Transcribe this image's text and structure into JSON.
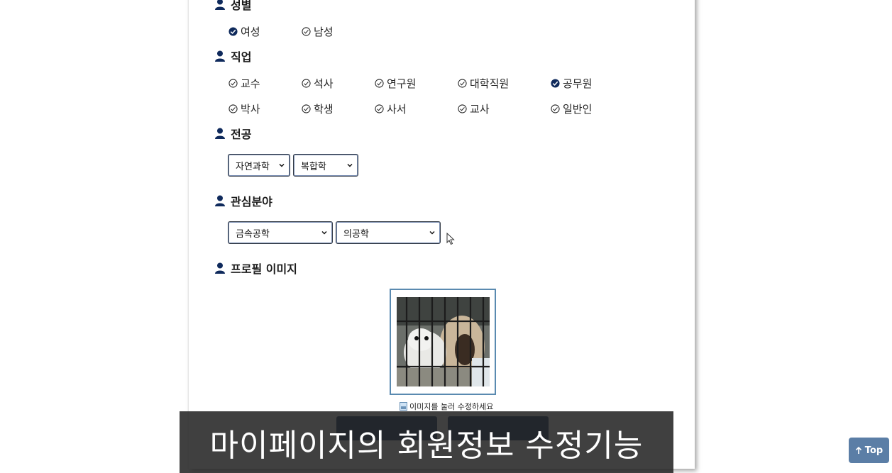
{
  "sections": {
    "gender": {
      "title": "성별",
      "options": [
        {
          "label": "여성",
          "checked": true
        },
        {
          "label": "남성",
          "checked": false
        }
      ]
    },
    "job": {
      "title": "직업",
      "options": [
        {
          "label": "교수",
          "checked": false
        },
        {
          "label": "석사",
          "checked": false
        },
        {
          "label": "연구원",
          "checked": false
        },
        {
          "label": "대학직원",
          "checked": false
        },
        {
          "label": "공무원",
          "checked": true
        },
        {
          "label": "박사",
          "checked": false
        },
        {
          "label": "학생",
          "checked": false
        },
        {
          "label": "사서",
          "checked": false
        },
        {
          "label": "교사",
          "checked": false
        },
        {
          "label": "일반인",
          "checked": false
        }
      ]
    },
    "major": {
      "title": "전공",
      "select1": "자연과학",
      "select2": "복합학"
    },
    "interest": {
      "title": "관심분야",
      "select1": "금속공학",
      "select2": "의공학"
    },
    "profile": {
      "title": "프로필 이미지",
      "hint": "이미지를 눌러 수정하세요"
    }
  },
  "caption": "마이페이지의 회원정보 수정기능",
  "top_button": "Top",
  "colors": {
    "navy": "#0f2a5c",
    "frame": "#5a8ab0",
    "top_btn": "#5b7ea6"
  },
  "icons": [
    "person-icon",
    "check-circle-icon",
    "chevron-down-icon",
    "image-file-icon",
    "arrow-up-icon",
    "cursor-icon"
  ]
}
